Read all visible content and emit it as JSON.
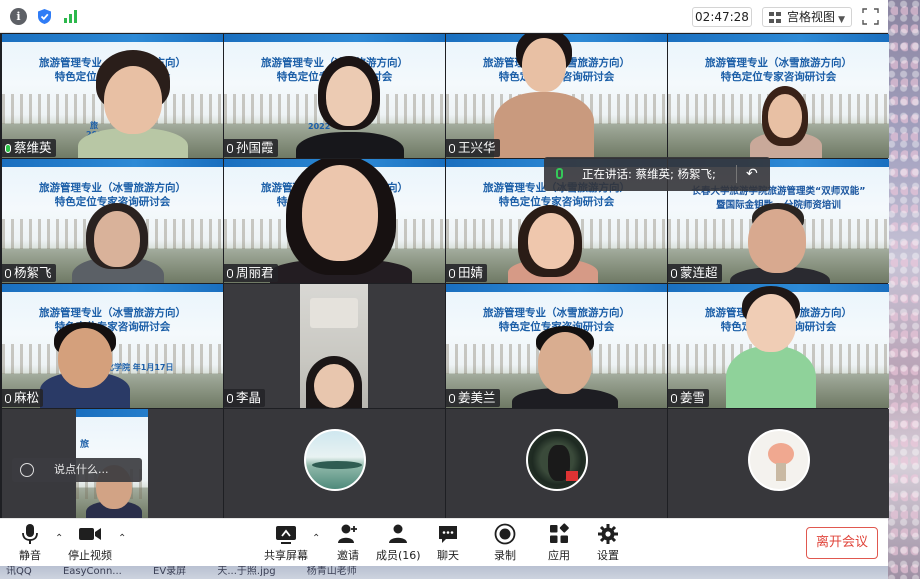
{
  "topbar": {
    "info_icon": "info-icon",
    "shield_icon": "shield-icon",
    "signal_icon": "signal-icon",
    "timer": "02:47:28",
    "view_label": "宫格视图",
    "fullscreen_icon": "fullscreen-icon"
  },
  "slide": {
    "line1": "旅游管理专业（冰雪旅游方向）",
    "line2": "特色定位专家咨询研讨会",
    "alt_line1": "长春大学旅游学院旅游管理类“双师双能”",
    "alt_line2": "暨国际金钥匙...分院师资培训",
    "fragment_2022": "2022",
    "fragment_date": "文化学院  年1月17日",
    "fragment_lv": "旅"
  },
  "participants": [
    {
      "name": "蔡维英",
      "active": true
    },
    {
      "name": "孙国霞",
      "active": false
    },
    {
      "name": "王兴华",
      "active": false
    },
    {
      "name": "",
      "active": false
    },
    {
      "name": "杨絮飞",
      "active": false
    },
    {
      "name": "周丽君",
      "active": false
    },
    {
      "name": "田婧",
      "active": false
    },
    {
      "name": "蒙连超",
      "active": false
    },
    {
      "name": "麻松",
      "active": false
    },
    {
      "name": "李晶",
      "active": false
    },
    {
      "name": "姜美兰",
      "active": false
    },
    {
      "name": "姜雪",
      "active": false
    }
  ],
  "speaking": {
    "text": "正在讲话: 蔡维英; 杨絮飞;",
    "back_symbol": "↶"
  },
  "chat": {
    "placeholder": "说点什么..."
  },
  "toolbar": {
    "mute": "静音",
    "stop_video": "停止视频",
    "share": "共享屏幕",
    "invite": "邀请",
    "members": "成员(16)",
    "chat": "聊天",
    "record": "录制",
    "apps": "应用",
    "settings": "设置",
    "leave": "离开会议"
  },
  "taskbar": {
    "items": [
      "讯QQ",
      "EasyConn...",
      "EV录屏",
      "天...于照.jpg",
      "杨青山老师"
    ]
  },
  "colors": {
    "accent_green": "#35c759",
    "leave_red": "#e0453b",
    "slide_blue": "#1c5fa8"
  }
}
